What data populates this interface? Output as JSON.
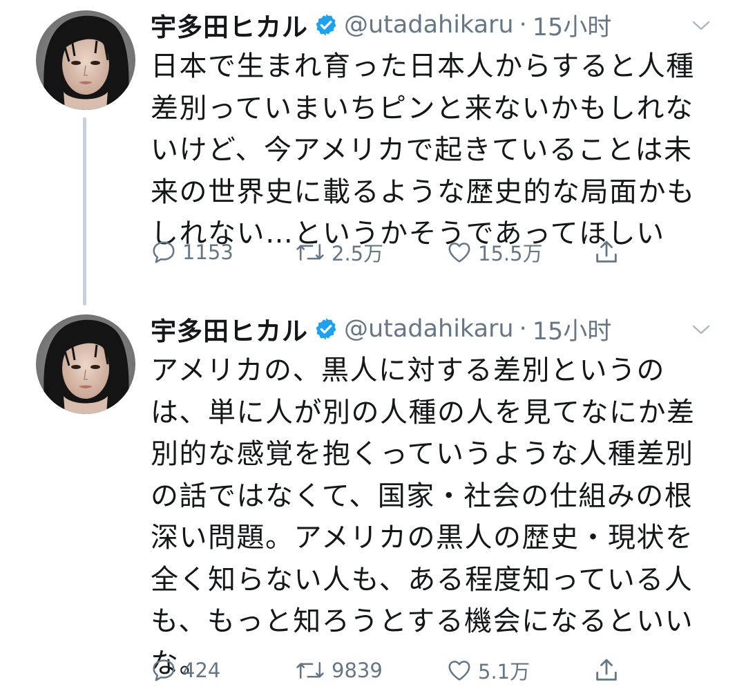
{
  "tweets": [
    {
      "author_name": "宇多田ヒカル",
      "handle": "@utadahikaru",
      "separator": "·",
      "time": "15小时",
      "text": "日本で生まれ育った日本人からすると人種差別っていまいちピンと来ないかもしれないけど、今アメリカで起きていることは未来の世界史に載るような歴史的な局面かもしれない…というかそうであってほしい",
      "replies": "1153",
      "retweets": "2.5万",
      "likes": "15.5万"
    },
    {
      "author_name": "宇多田ヒカル",
      "handle": "@utadahikaru",
      "separator": "·",
      "time": "15小时",
      "text": "アメリカの、黒人に対する差別というのは、単に人が別の人種の人を見てなにか差別的な感覚を抱くっていうような人種差別の話ではなくて、国家・社会の仕組みの根深い問題。アメリカの黒人の歴史・現状を全く知らない人も、ある程度知っている人も、もっと知ろうとする機会になるといいな。",
      "replies": "424",
      "retweets": "9839",
      "likes": "5.1万"
    }
  ],
  "colors": {
    "text": "#14171a",
    "secondary": "#657786",
    "verified": "#1da1f2",
    "thread_line": "#c8d1d9"
  },
  "icons": {
    "verified": "verified-badge-icon",
    "caret": "chevron-down-icon",
    "reply": "reply-bubble-icon",
    "retweet": "retweet-icon",
    "like": "heart-icon",
    "share": "share-icon"
  }
}
